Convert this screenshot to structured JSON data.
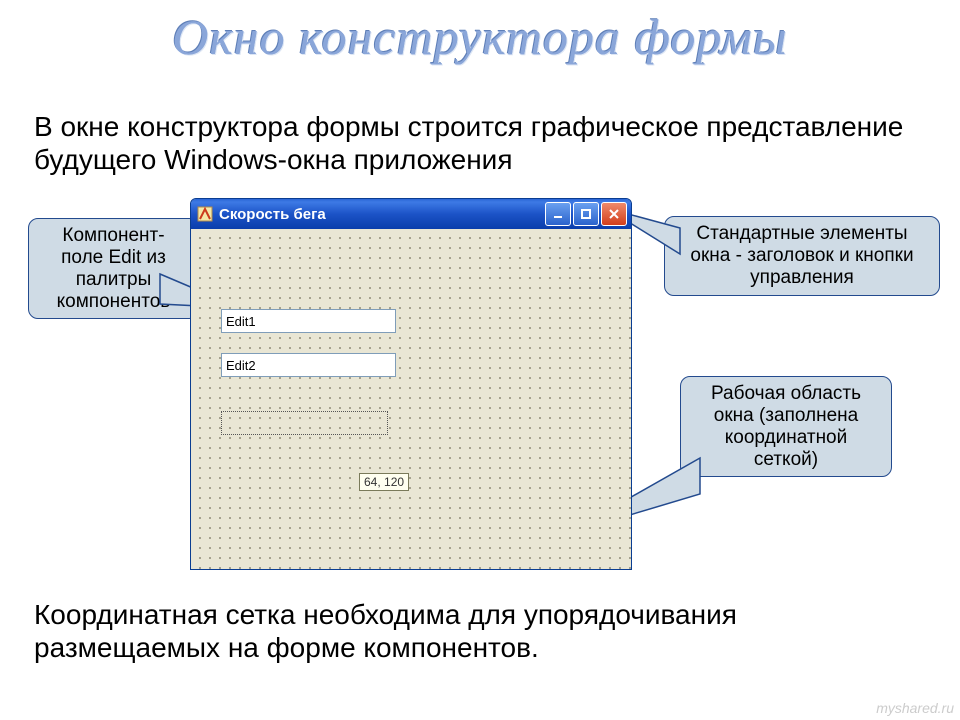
{
  "title": "Окно конструктора формы",
  "para_top": "В окне конструктора формы строится графическое представление будущего  Windows-окна приложения",
  "para_bottom": "Координатная сетка необходима для упорядочивания размещаемых на форме компонентов.",
  "callouts": {
    "edit_component": "Компонент-\nполе Edit из палитры компонентов",
    "standart_elements": "Стандартные элементы окна - заголовок и кнопки управления",
    "working_area": "Рабочая область окна (заполнена координатной сеткой)"
  },
  "window": {
    "caption": "Скорость бега",
    "edits": [
      "Edit1",
      "Edit2"
    ],
    "coord_hint": "64, 120"
  },
  "watermark": "myshared.ru"
}
